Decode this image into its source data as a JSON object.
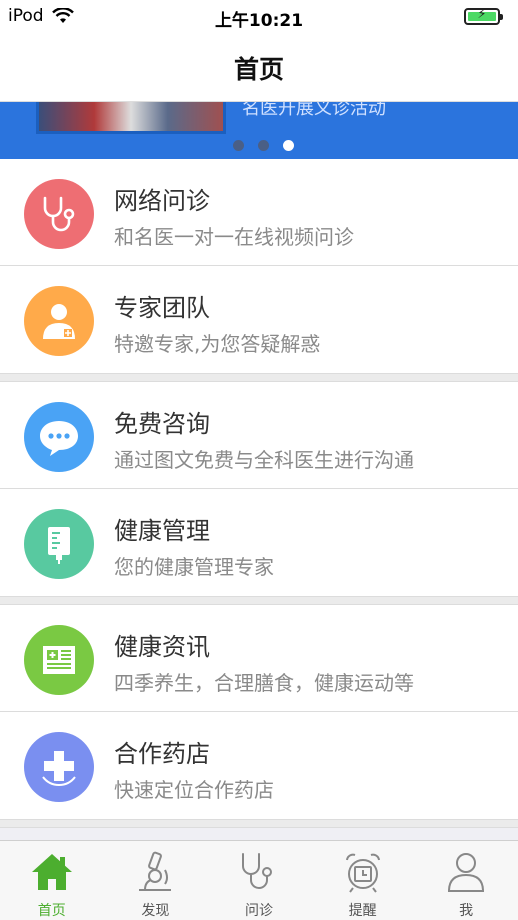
{
  "status_bar": {
    "carrier": "iPod",
    "time": "上午10:21"
  },
  "nav": {
    "title": "首页"
  },
  "banner": {
    "text": "名医开展义诊活动",
    "dot_count": 3,
    "active_dot": 3
  },
  "menu": {
    "groups": [
      [
        {
          "title": "网络问诊",
          "subtitle": "和名医一对一在线视频问诊",
          "icon": "stethoscope-icon",
          "color": "#ee6e73"
        },
        {
          "title": "专家团队",
          "subtitle": "特邀专家,为您答疑解惑",
          "icon": "doctor-icon",
          "color": "#ffaa4a"
        }
      ],
      [
        {
          "title": "免费咨询",
          "subtitle": "通过图文免费与全科医生进行沟通",
          "icon": "chat-bubble-icon",
          "color": "#4aa3f5"
        },
        {
          "title": "健康管理",
          "subtitle": "您的健康管理专家",
          "icon": "iv-bag-icon",
          "color": "#58c9a0"
        }
      ],
      [
        {
          "title": "健康资讯",
          "subtitle": "四季养生，合理膳食，健康运动等",
          "icon": "newspaper-icon",
          "color": "#7ac943"
        },
        {
          "title": "合作药店",
          "subtitle": "快速定位合作药店",
          "icon": "pharmacy-cross-icon",
          "color": "#7a8ff0"
        }
      ]
    ]
  },
  "tabs": [
    {
      "label": "首页",
      "icon": "home-icon",
      "active": true
    },
    {
      "label": "发现",
      "icon": "microscope-icon",
      "active": false
    },
    {
      "label": "问诊",
      "icon": "stethoscope-icon",
      "active": false
    },
    {
      "label": "提醒",
      "icon": "alarm-clock-icon",
      "active": false
    },
    {
      "label": "我",
      "icon": "person-icon",
      "active": false
    }
  ],
  "colors": {
    "accent": "#4cae2f",
    "banner": "#2b74dd",
    "battery": "#4cd964"
  }
}
